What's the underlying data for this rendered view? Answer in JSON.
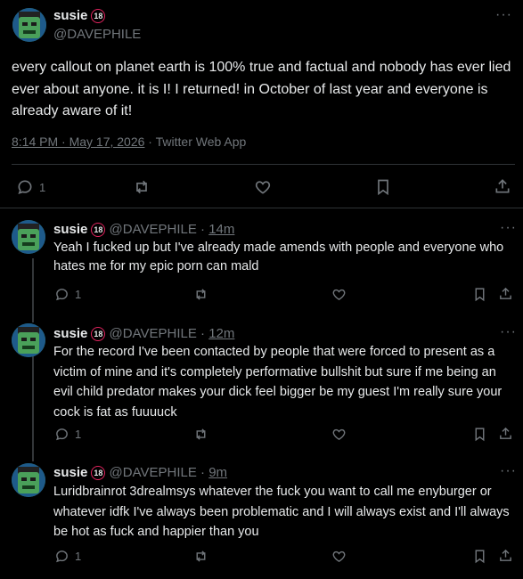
{
  "main": {
    "name": "susie",
    "badge": "18",
    "handle": "@DAVEPHILE",
    "text": "every callout on planet earth is 100% true and factual and nobody has ever lied ever about anyone. it is I! I returned! in October of last year and everyone is already aware of it!",
    "timestamp": "8:14 PM · May 17, 2026",
    "separator": " · ",
    "client": "Twitter Web App",
    "reply_count": "1"
  },
  "replies": [
    {
      "name": "susie",
      "badge": "18",
      "handle": "@DAVEPHILE",
      "sep": "·",
      "time": "14m",
      "text": "Yeah I fucked up but I've already made amends with people and everyone who hates me for my epic porn can mald",
      "reply_count": "1"
    },
    {
      "name": "susie",
      "badge": "18",
      "handle": "@DAVEPHILE",
      "sep": "·",
      "time": "12m",
      "text": "For the record I've been contacted by people that were forced to present as a victim of mine and it's completely performative bullshit but sure if me being an evil child predator makes your dick feel bigger be my guest I'm really sure your cock is fat as fuuuuck",
      "reply_count": "1"
    },
    {
      "name": "susie",
      "badge": "18",
      "handle": "@DAVEPHILE",
      "sep": "·",
      "time": "9m",
      "text": "Luridbrainrot 3drealmsys whatever the fuck you want to call me enyburger or whatever idfk I've always been problematic and I will always exist and I'll always be hot as fuck and happier than you",
      "reply_count": "1"
    }
  ],
  "more_glyph": "···",
  "colors": {
    "background": "#000000",
    "text": "#e7e9ea",
    "muted": "#71767b",
    "badge_ring": "#e0245e",
    "divider": "#2f3336"
  }
}
